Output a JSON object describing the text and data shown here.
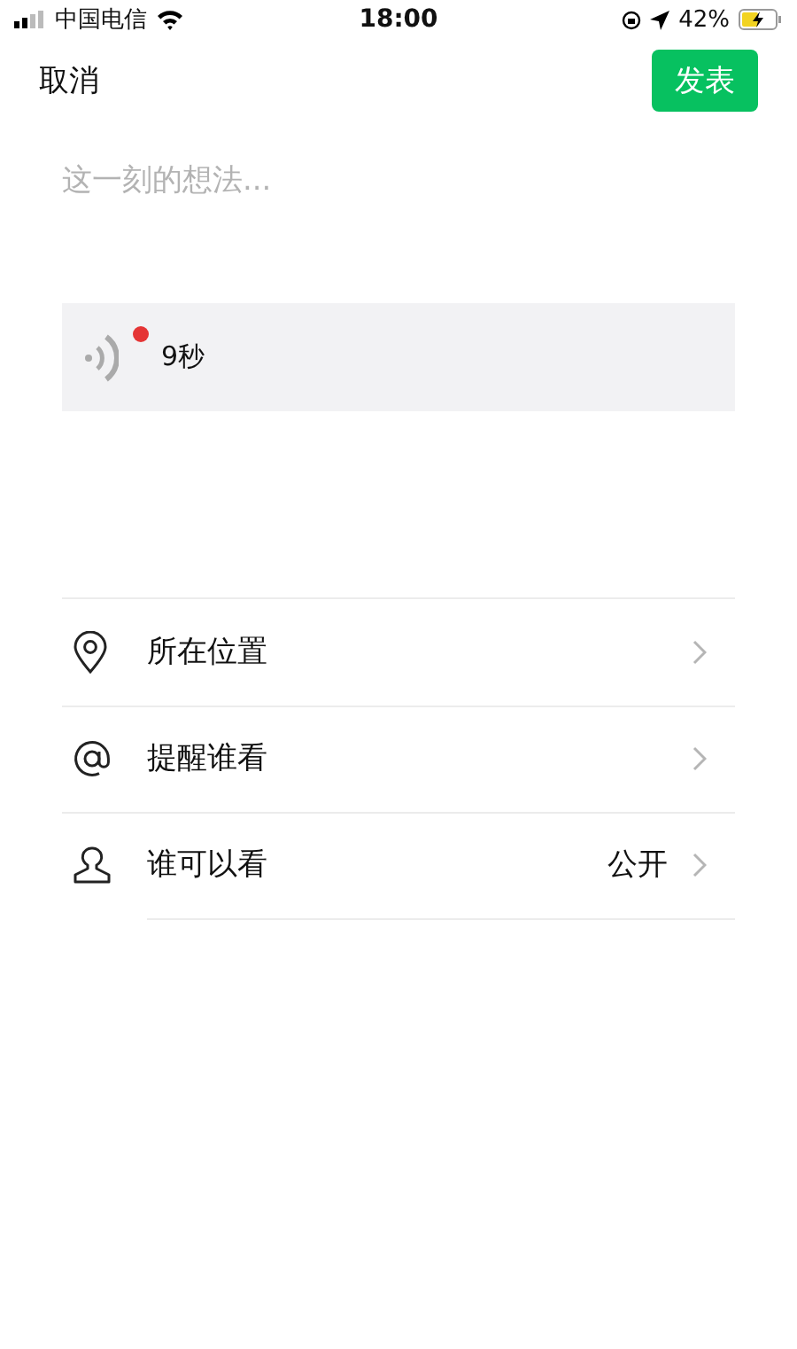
{
  "status_bar": {
    "carrier": "中国电信",
    "time": "18:00",
    "battery": "42%"
  },
  "nav": {
    "cancel": "取消",
    "publish": "发表"
  },
  "composer": {
    "placeholder": "这一刻的想法..."
  },
  "voice": {
    "duration": "9秒",
    "unread": true
  },
  "options": [
    {
      "kind": "location",
      "label": "所在位置"
    },
    {
      "kind": "mention",
      "label": "提醒谁看"
    },
    {
      "kind": "visibility",
      "label": "谁可以看",
      "value": "公开"
    }
  ]
}
